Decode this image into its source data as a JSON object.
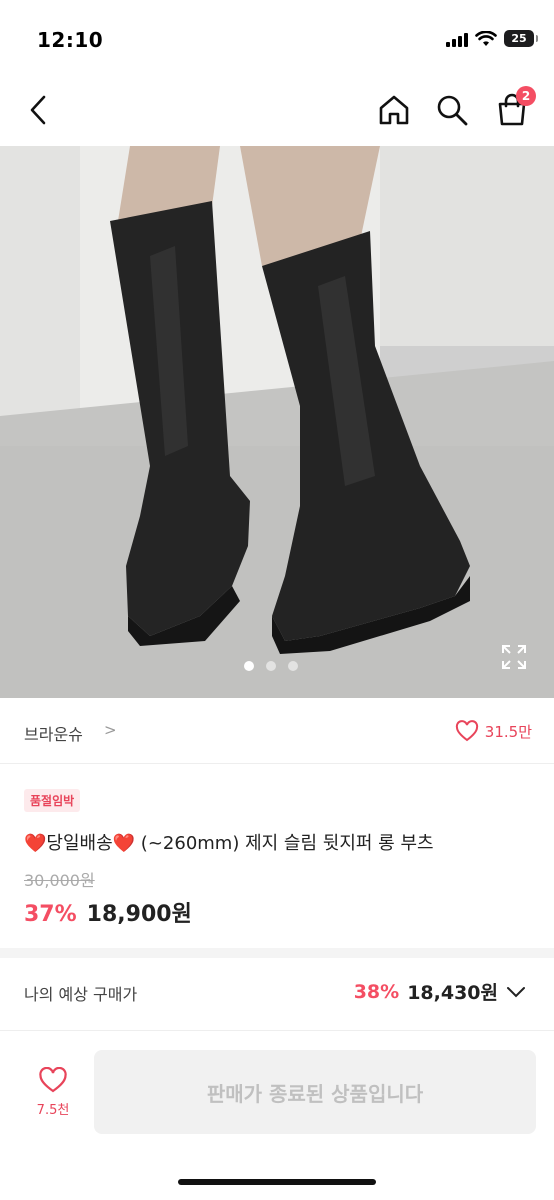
{
  "status_bar": {
    "time": "12:10",
    "battery": "25"
  },
  "nav": {
    "cart_count": "2"
  },
  "hero": {
    "dots_total": 3,
    "active_index": 0
  },
  "brand": {
    "name": "브라운슈",
    "chevron": ">",
    "like_count": "31.5만"
  },
  "product": {
    "badge": "품절임박",
    "title_prefix": "❤️",
    "title_tag": "당일배송",
    "title_rest": "❤️ (~260mm) 제지 슬림 뒷지퍼 롱 부츠",
    "original_price": "30,000원",
    "discount": "37%",
    "sale_price": "18,900원"
  },
  "expected_price": {
    "label": "나의 예상 구매가",
    "discount": "38%",
    "price": "18,430원"
  },
  "bottom_bar": {
    "like_count": "7.5천",
    "button_label": "판매가 종료된 상품입니다"
  },
  "colors": {
    "accent": "#f44e63",
    "like": "#e8445a",
    "disabled_bg": "#f1f1f1"
  }
}
